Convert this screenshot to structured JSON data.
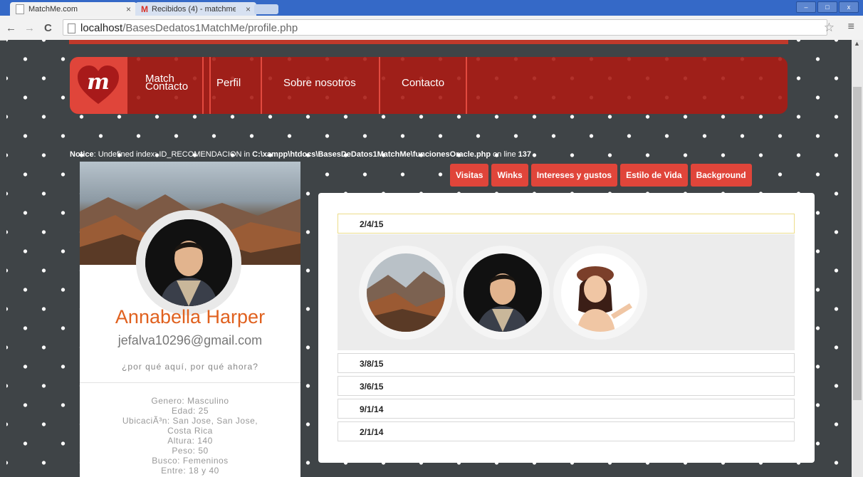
{
  "browser": {
    "tabs": [
      {
        "label": "MatchMe.com",
        "close": "×"
      },
      {
        "label": "Recibidos (4) - matchme",
        "close": "×"
      }
    ],
    "window_buttons": [
      "–",
      "□",
      "x"
    ],
    "back": "←",
    "forward": "→",
    "reload": "C",
    "url_host": "localhost",
    "url_path": "/BasesDedatos1MatchMe/profile.php",
    "bookmark": "☆",
    "menu": "≡"
  },
  "nav": {
    "logo_letter": "m",
    "links": [
      "Match",
      "Contacto",
      "Perfil",
      "Sobre nosotros",
      "Contacto"
    ]
  },
  "notice": {
    "label": "Notice",
    "text1": ": Undefined index: ID_RECOMENDACION in ",
    "path": "C:\\xampp\\htdocs\\BasesDeDatos1MatchMe\\funcionesOracle.php",
    "text2": " on line ",
    "line": "137"
  },
  "profile_tabs": [
    "Visitas",
    "Winks",
    "Intereses y gustos",
    "Estilo de Vida",
    "Background"
  ],
  "profile": {
    "name": "Annabella Harper",
    "email": "jefalva10296@gmail.com",
    "tagline": "¿por qué aquí, por qué ahora?",
    "details": [
      "Genero: Masculino",
      "Edad: 25",
      "UbicaciÃ³n: San Jose, San Jose,",
      "Costa Rica",
      "Altura: 140",
      "Peso: 50",
      "Busco: Femeninos",
      "Entre: 18 y 40"
    ]
  },
  "visits": {
    "dates": [
      "2/4/15",
      "3/8/15",
      "3/6/15",
      "9/1/14",
      "2/1/14"
    ],
    "thumbs": [
      "mountain-photo",
      "young-man-photo",
      "woman-photo"
    ]
  },
  "colors": {
    "accent": "#e0453a",
    "navbar": "#aa1c14",
    "name": "#e0611f",
    "background": "#3f4447"
  }
}
